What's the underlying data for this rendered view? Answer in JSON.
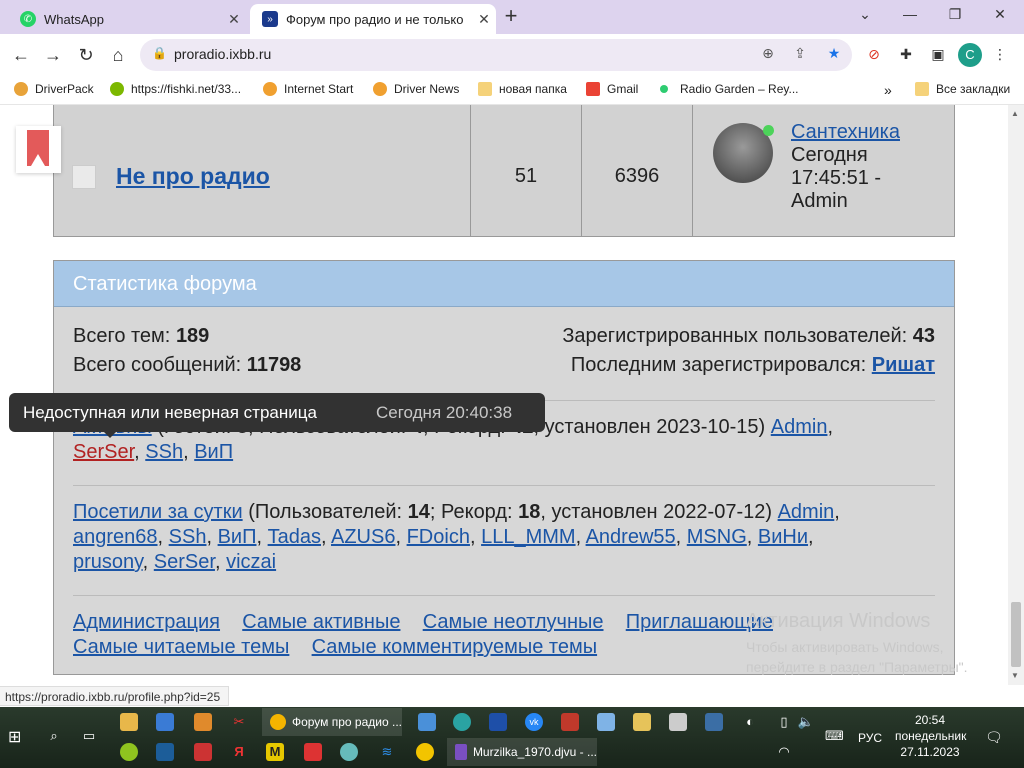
{
  "tabs": [
    {
      "label": "WhatsApp",
      "color": "#25d366"
    },
    {
      "label": "Форум про радио и не только",
      "color": "#1b3a8c"
    }
  ],
  "address": {
    "url": "proradio.ixbb.ru"
  },
  "profile_letter": "C",
  "bookmarks": [
    {
      "label": "DriverPack"
    },
    {
      "label": "https://fishki.net/33..."
    },
    {
      "label": "Internet Start"
    },
    {
      "label": "Driver News"
    },
    {
      "label": "новая папка"
    },
    {
      "label": "Gmail"
    },
    {
      "label": "Radio Garden – Rey..."
    },
    {
      "label": "»"
    },
    {
      "label": "Все закладки"
    }
  ],
  "forum": {
    "title": "Не про радио",
    "topics": "51",
    "posts": "6396",
    "last_user": "Сантехника",
    "last_line1": "Сегодня",
    "last_line2": "17:45:51 -",
    "last_line3": "Admin"
  },
  "stats": {
    "heading": "Статистика форума",
    "total_topics_label": "Всего тем:",
    "total_topics": "189",
    "total_posts_label": "Всего сообщений:",
    "total_posts": "11798",
    "registered_label": "Зарегистрированных пользователей:",
    "registered": "43",
    "last_reg_label": "Последним зарегистрировался:",
    "last_reg": "Ришат",
    "active_link": "Активны",
    "active_guests_label": "(Гостей:",
    "active_guests": "3",
    "active_users_label": ", Пользователей:",
    "active_users": "4",
    "active_record_label": "; Рекорд:",
    "active_record": "42",
    "active_record_date": ", установлен 2023-10-15)",
    "active_names": [
      "Admin",
      "SerSer",
      "SSh",
      "ВиП"
    ],
    "day_link": "Посетили за сутки",
    "day_users_label": "(Пользователей:",
    "day_users": "14",
    "day_record_label": "; Рекорд:",
    "day_record": "18",
    "day_record_date": ", установлен 2022-07-12)",
    "day_names": [
      "Admin",
      "angren68",
      "SSh",
      "ВиП",
      "Tadas",
      "AZUS6",
      "FDoich",
      "LLL_MMM",
      "Andrew55",
      "MSNG",
      "ВиНи",
      "prusony",
      "SerSer",
      "viczai"
    ],
    "bottom_links": [
      "Администрация",
      "Самые активные",
      "Самые неотлучные",
      "Приглашающие",
      "Самые читаемые темы",
      "Самые комментируемые темы"
    ]
  },
  "tooltip": {
    "text": "Недоступная или неверная страница",
    "time": "Сегодня 20:40:38"
  },
  "watermark": {
    "title": "Активация Windows",
    "line1": "Чтобы активировать Windows,",
    "line2": "перейдите в раздел \"Параметры\"."
  },
  "status_url": "https://proradio.ixbb.ru/profile.php?id=25",
  "taskbar": {
    "task1": "Форум про радио ...",
    "task2": "Murzilka_1970.djvu - ...",
    "lang": "РУС",
    "time": "20:54",
    "day": "понедельник",
    "date": "27.11.2023"
  }
}
